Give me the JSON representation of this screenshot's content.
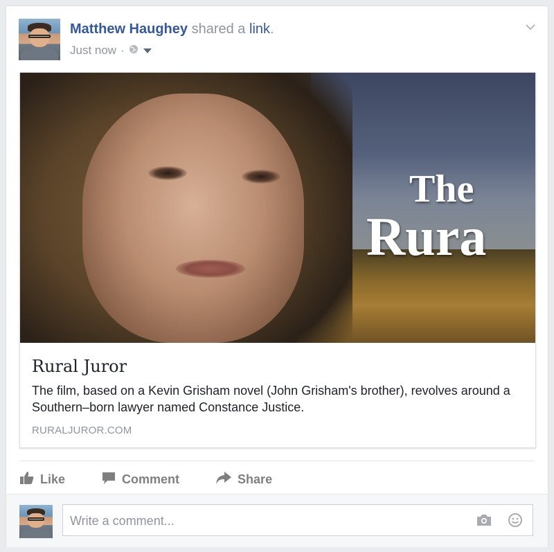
{
  "post": {
    "author": "Matthew Haughey",
    "action_text": "shared a",
    "action_link": "link",
    "action_end": ".",
    "timestamp": "Just now",
    "separator": "·"
  },
  "link_preview": {
    "image_title_line1": "The",
    "image_title_line2": "Rura",
    "title": "Rural Juror",
    "description": "The film, based on a Kevin Grisham novel (John Grisham's brother), revolves around a Southern–born lawyer named Constance Justice.",
    "domain": "RURALJUROR.COM"
  },
  "actions": {
    "like": "Like",
    "comment": "Comment",
    "share": "Share"
  },
  "comment_box": {
    "placeholder": "Write a comment..."
  },
  "icons": {
    "privacy": "globe-icon",
    "privacy_menu": "caret-down-icon",
    "post_menu": "chevron-down-icon",
    "like": "thumbs-up-icon",
    "comment": "speech-bubble-icon",
    "share": "share-arrow-icon",
    "camera": "camera-icon",
    "emoji": "smiley-icon"
  },
  "colors": {
    "author_link": "#365899",
    "secondary_text": "#90949c",
    "action_text": "#7f7f7f"
  }
}
